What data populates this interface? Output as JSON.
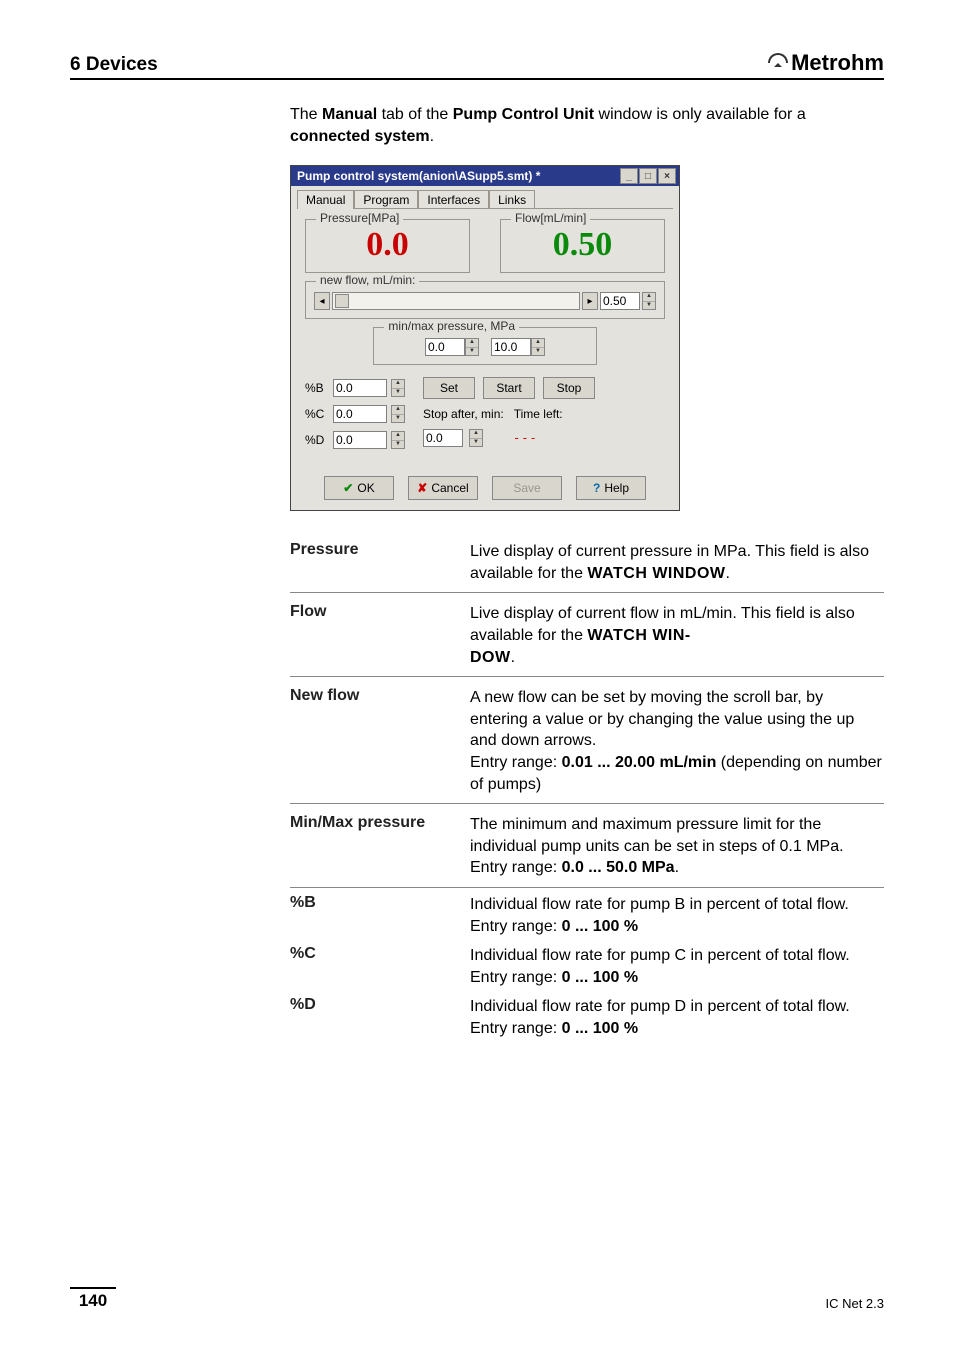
{
  "header": {
    "chapter": "6  Devices",
    "brand": "Metrohm"
  },
  "intro": {
    "pre": "The ",
    "tab": "Manual",
    "mid1": " tab of the ",
    "win": "Pump Control Unit",
    "mid2": " window is only available for a ",
    "conn": "connected system",
    "post": "."
  },
  "window": {
    "title": "Pump control system(anion\\ASupp5.smt) *",
    "tabs": [
      "Manual",
      "Program",
      "Interfaces",
      "Links"
    ],
    "pressure_legend": "Pressure[MPa]",
    "pressure_value": "0.0",
    "flow_legend": "Flow[mL/min]",
    "flow_value": "0.50",
    "newflow_legend": "new flow, mL/min:",
    "newflow_value": "0.50",
    "minmax_legend": "min/max pressure, MPa",
    "min_value": "0.0",
    "max_value": "10.0",
    "pctB_label": "%B",
    "pctB_value": "0.0",
    "pctC_label": "%C",
    "pctC_value": "0.0",
    "pctD_label": "%D",
    "pctD_value": "0.0",
    "set_btn": "Set",
    "start_btn": "Start",
    "stop_btn": "Stop",
    "stop_after_label": "Stop after, min:",
    "time_left_label": "Time left:",
    "stop_after_value": "0.0",
    "time_left_value": "---",
    "ok": "OK",
    "cancel": "Cancel",
    "save": "Save",
    "help": "Help"
  },
  "defs": {
    "pressure_term": "Pressure",
    "pressure_desc_a": "Live display of current pressure in MPa. This field is also available for the ",
    "watch_window": "WATCH WINDOW",
    "dot": ".",
    "flow_term": "Flow",
    "flow_desc_a": "Live display of current flow in mL/min. This field is also available for the ",
    "watch_win_a": "WATCH WIN-",
    "watch_win_b": "DOW",
    "newflow_term": "New flow",
    "newflow_desc_a": "A new flow can be set by moving the scroll bar, by entering a value or by changing the value using the up and down arrows.",
    "newflow_desc_b": "Entry range: ",
    "newflow_range": "0.01 ... 20.00 mL/min",
    "newflow_desc_c": " (depending on number of pumps)",
    "minmax_term": "Min/Max pressure",
    "minmax_desc_a": "The minimum and maximum pressure limit for the individual pump units can be set in steps of 0.1 MPa.",
    "minmax_desc_b": "Entry range: ",
    "minmax_range": "0.0 ... 50.0 MPa",
    "pctB_term": "%B",
    "pctB_desc": "Individual flow rate for pump B in percent of total flow.",
    "pct_entry": "Entry range: ",
    "pct_range": "0 ... 100 %",
    "pctC_term": "%C",
    "pctC_desc": "Individual flow rate for pump C in percent of total flow.",
    "pctD_term": "%D",
    "pctD_desc": "Individual flow rate for pump D in percent of total flow."
  },
  "footer": {
    "page": "140",
    "product": "IC Net 2.3"
  }
}
